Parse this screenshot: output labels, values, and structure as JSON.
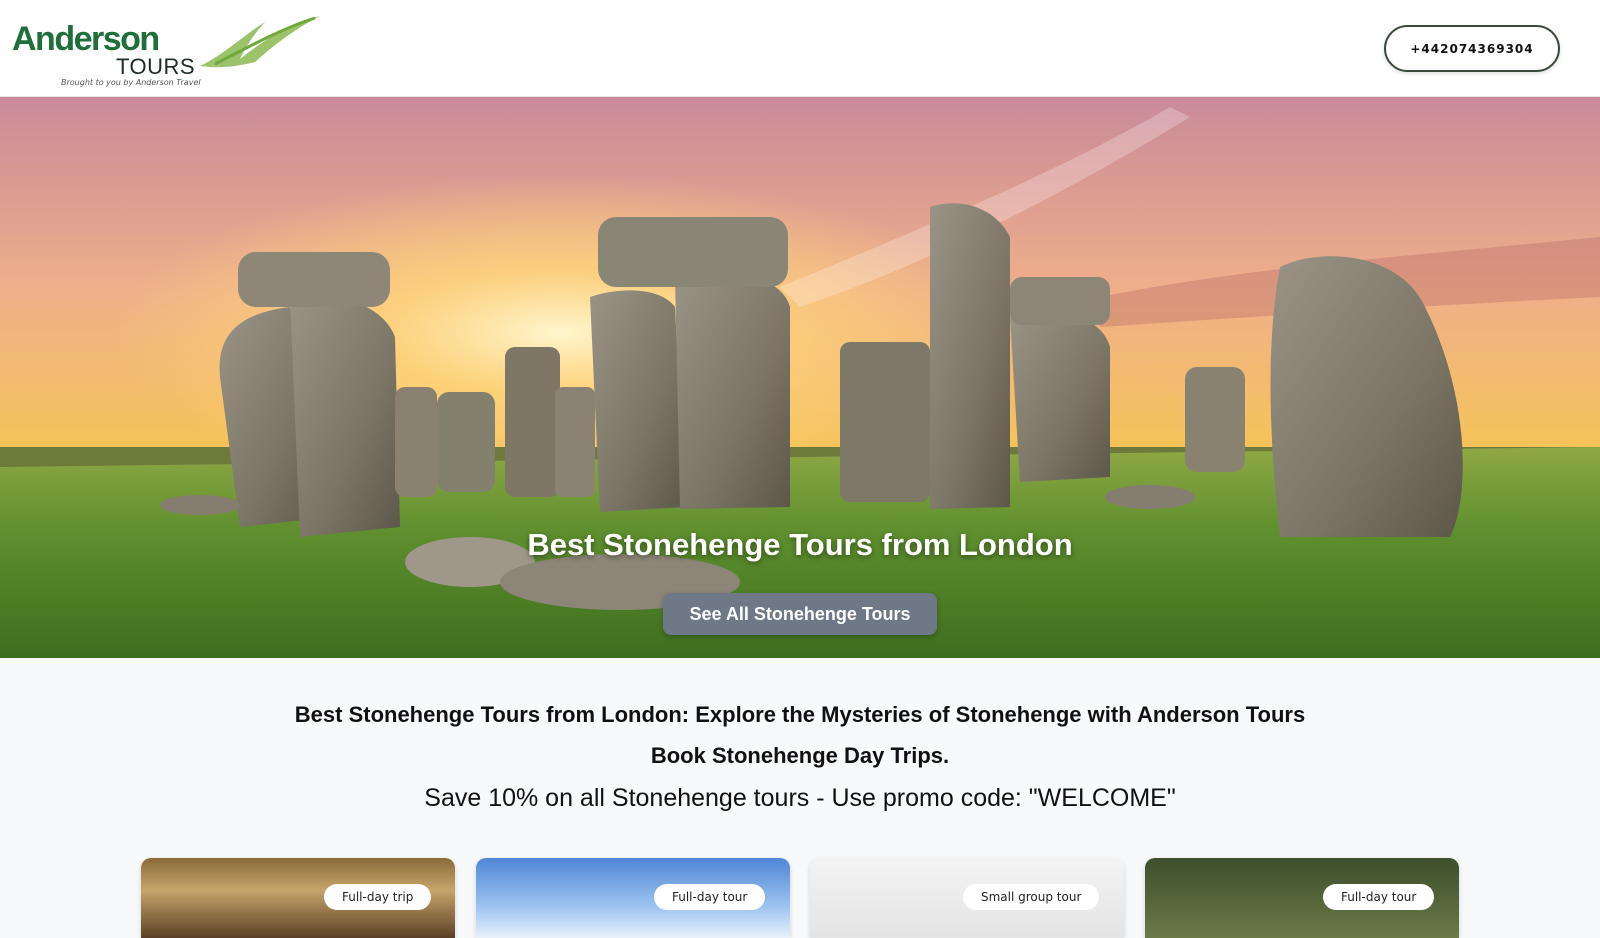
{
  "header": {
    "logo": {
      "name": "Anderson",
      "sub": "TOURS",
      "tagline": "Brought to you by Anderson Travel"
    },
    "phone": "+442074369304"
  },
  "hero": {
    "title": "Best Stonehenge Tours from London",
    "cta": "See All Stonehenge Tours"
  },
  "intro": {
    "heading": "Best Stonehenge Tours from London: Explore the Mysteries of Stonehenge with Anderson Tours",
    "subheading": "Book Stonehenge Day Trips.",
    "promo": "Save 10% on all Stonehenge tours - Use promo code: \"WELCOME\""
  },
  "cards": [
    {
      "badge": "Full-day trip"
    },
    {
      "badge": "Full-day tour"
    },
    {
      "badge": "Small group tour"
    },
    {
      "badge": "Full-day tour"
    }
  ],
  "colors": {
    "brand_green": "#1f6f3a",
    "cta_grey": "#6e7886"
  }
}
